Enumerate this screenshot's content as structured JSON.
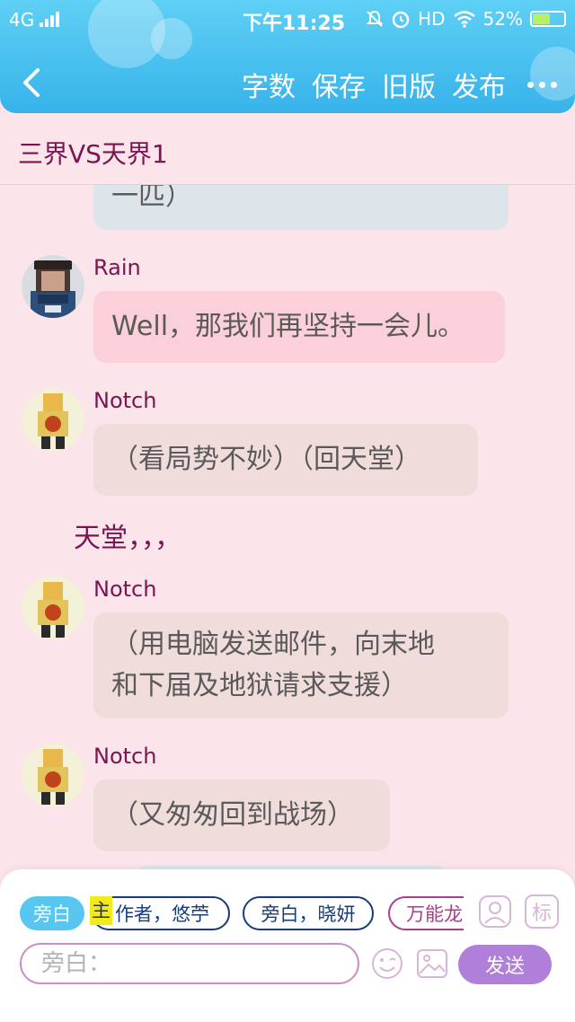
{
  "status_bar": {
    "network": "4G",
    "time": "下午11:25",
    "hd": "HD",
    "battery": "52%",
    "battery_level": 0.52
  },
  "toolbar": {
    "word_count": "字数",
    "save": "保存",
    "old_version": "旧版",
    "publish": "发布"
  },
  "story": {
    "title": "三界VS天界1"
  },
  "messages": [
    {
      "text": "一匹）"
    },
    {
      "name": "Rain",
      "text": "Well，那我们再坚持一会儿。"
    },
    {
      "name": "Notch",
      "text": "（看局势不妙）（回天堂）"
    },
    {
      "narration": "天堂，，，"
    },
    {
      "name": "Notch",
      "line1": "（用电脑发送邮件，向末地",
      "line2": "和下届及地狱请求支援）"
    },
    {
      "name": "Notch",
      "text": "（又匆匆回到战场）"
    }
  ],
  "composer": {
    "chips": [
      "旁白",
      "作者，悠苧",
      "旁白，晓妍",
      "万能龙"
    ],
    "main_tag": "主",
    "label_button": "标",
    "input_placeholder": "旁白：",
    "send": "发送"
  },
  "icons": {
    "back": "chevron-left-icon",
    "more": "more-dots-icon",
    "emoji": "smiley-icon",
    "image": "image-icon",
    "person": "person-icon"
  },
  "colors": {
    "header": "#37b3ea",
    "background": "#fbe4ea",
    "accent_text": "#7a1550",
    "send_button": "#b07fd9",
    "rain_bubble": "#fbd0d9",
    "notch_bubble": "#f1dcdc",
    "blue_bubble": "#dde4ea",
    "chip_border": "#173e7a",
    "chip_active": "#57c6f0",
    "highlight": "#f0ec1c"
  }
}
